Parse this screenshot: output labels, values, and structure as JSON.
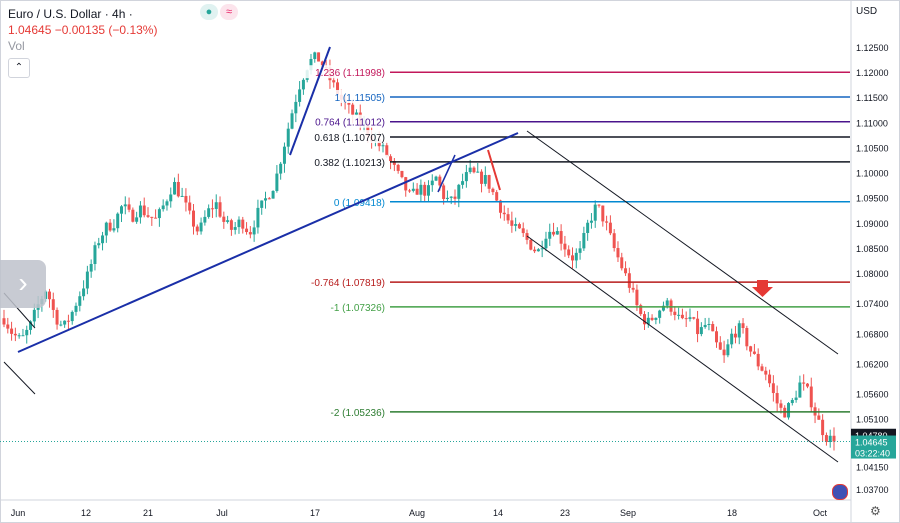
{
  "header": {
    "title": "Euro / U.S. Dollar · 4h · ",
    "quote": "1.04645 −0.00135 (−0.13%)",
    "vol_label": "Vol",
    "icons": [
      "live-dot-icon",
      "wave-indicator-icon"
    ]
  },
  "axis": {
    "currency": "USD",
    "y_ticks": [
      "1.12500",
      "1.12000",
      "1.11500",
      "1.11000",
      "1.10500",
      "1.10000",
      "1.09500",
      "1.09000",
      "1.08500",
      "1.08000",
      "1.07400",
      "1.06800",
      "1.06200",
      "1.05600",
      "1.05100",
      "1.04150",
      "1.03700"
    ],
    "x_ticks": [
      "Jun",
      "12",
      "21",
      "Jul",
      "17",
      "Aug",
      "14",
      "23",
      "Sep",
      "18",
      "Oct"
    ]
  },
  "price_tags": [
    {
      "text": "1.04780",
      "bg": "#131722"
    },
    {
      "text": "1.04645",
      "bg": "#26a69a"
    },
    {
      "text": "03:22:40",
      "bg": "#26a69a"
    }
  ],
  "colors": {
    "up": "#26a69a",
    "down": "#ef5350",
    "trendline": "#1a2fa8",
    "channel": "#131722"
  },
  "chart_data": {
    "type": "candlestick",
    "symbol": "EURUSD",
    "timeframe": "4h",
    "ylim": [
      1.036,
      1.13
    ],
    "fib_levels": [
      {
        "label": "1.236 (1.11998)",
        "value": 1.11998,
        "color": "#c2185b"
      },
      {
        "label": "1 (1.11505)",
        "value": 1.11505,
        "color": "#1565c0"
      },
      {
        "label": "0.764 (1.11012)",
        "value": 1.11012,
        "color": "#4a148c"
      },
      {
        "label": "0.618 (1.10707)",
        "value": 1.10707,
        "color": "#131722"
      },
      {
        "label": "0.382 (1.10213)",
        "value": 1.10213,
        "color": "#131722"
      },
      {
        "label": "0 (1.09418)",
        "value": 1.09418,
        "color": "#0288d1"
      },
      {
        "label": "-0.764 (1.07819)",
        "value": 1.07819,
        "color": "#b71c1c"
      },
      {
        "label": "-1 (1.07326)",
        "value": 1.07326,
        "color": "#43a047"
      },
      {
        "label": "-2 (1.05236)",
        "value": 1.05236,
        "color": "#2e7d32"
      }
    ],
    "current_price": 1.04645,
    "close_path": [
      1.071,
      1.068,
      1.0665,
      1.069,
      1.0735,
      1.077,
      1.0715,
      1.069,
      1.072,
      1.076,
      1.08,
      1.086,
      1.089,
      1.09,
      1.0935,
      1.091,
      1.093,
      1.0915,
      1.0905,
      1.094,
      1.098,
      1.095,
      1.091,
      1.088,
      1.092,
      1.094,
      1.09,
      1.0885,
      1.0905,
      1.088,
      1.092,
      1.095,
      1.098,
      1.105,
      1.112,
      1.118,
      1.122,
      1.123,
      1.12,
      1.117,
      1.114,
      1.112,
      1.11,
      1.108,
      1.106,
      1.104,
      1.101,
      1.098,
      1.095,
      1.097,
      1.096,
      1.099,
      1.095,
      1.094,
      1.098,
      1.1,
      1.099,
      1.0985,
      1.095,
      1.092,
      1.089,
      1.088,
      1.086,
      1.084,
      1.088,
      1.089,
      1.086,
      1.083,
      1.084,
      1.09,
      1.0935,
      1.09,
      1.085,
      1.081,
      1.077,
      1.072,
      1.07,
      1.072,
      1.074,
      1.073,
      1.07,
      1.071,
      1.068,
      1.07,
      1.066,
      1.063,
      1.068,
      1.069,
      1.065,
      1.062,
      1.06,
      1.055,
      1.052,
      1.054,
      1.058,
      1.056,
      1.051,
      1.0475,
      1.04645
    ]
  }
}
